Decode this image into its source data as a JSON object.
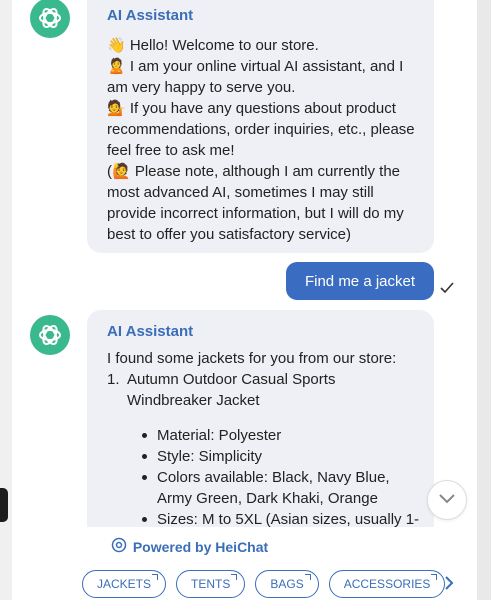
{
  "assistant_name": "AI Assistant",
  "welcome_message": {
    "lines": [
      "👋 Hello! Welcome to our store.",
      "🙎 I am your online virtual AI assistant, and I am very happy to serve you.",
      "💁 If you have any questions about product recommendations, order inquiries, etc., please feel free to ask me!",
      "(🙋 Please note, although I am currently the most advanced AI, sometimes I may still provide incorrect information, but I will do my best to offer you satisfactory service)"
    ]
  },
  "user_message": {
    "text": "Find me a jacket",
    "status_icon": "checkmark"
  },
  "reply_message": {
    "intro": "I found some jackets for you from our store:",
    "items": [
      {
        "number": "1.",
        "title": "Autumn Outdoor Casual Sports Windbreaker Jacket",
        "details": [
          "Material: Polyester",
          "Style: Simplicity",
          "Colors available: Black, Navy Blue, Army Green, Dark Khaki, Orange",
          "Sizes: M to 5XL (Asian sizes, usually 1-"
        ]
      }
    ]
  },
  "footer": {
    "powered_by": "Powered by HeiChat",
    "chips": [
      "JACKETS",
      "TENTS",
      "BAGS",
      "ACCESSORIES"
    ]
  },
  "icons": {
    "assistant_logo": "openai-logo-icon",
    "scroll_down": "chevron-down-icon",
    "next": "chevron-right-icon",
    "powered": "heichat-logo-icon"
  },
  "colors": {
    "accent": "#3a6eb8",
    "user_bubble": "#3a6cc2",
    "ai_bubble": "#eef0f6",
    "logo_green": "#39b98d"
  }
}
